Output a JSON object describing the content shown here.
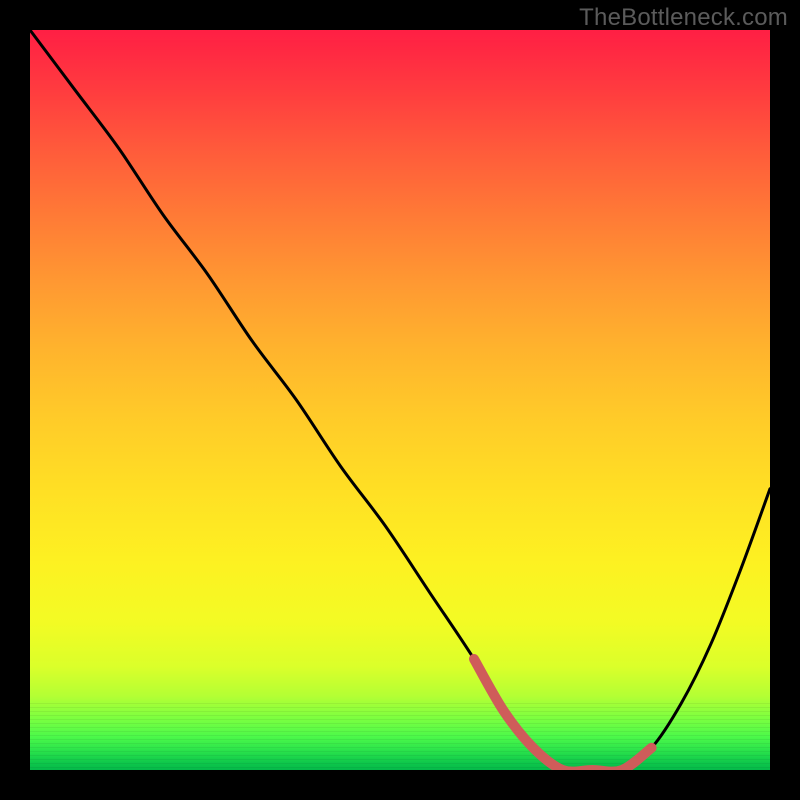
{
  "watermark": "TheBottleneck.com",
  "colors": {
    "page_bg": "#000000",
    "watermark": "#5b5b5b",
    "curve_stroke": "#000000",
    "highlight_stroke": "#cf5c5a",
    "gradient_top": "#ff1f44",
    "gradient_bottom": "#05b94a"
  },
  "chart_data": {
    "type": "line",
    "title": "",
    "xlabel": "",
    "ylabel": "",
    "xlim": [
      0,
      100
    ],
    "ylim": [
      0,
      100
    ],
    "series": [
      {
        "name": "bottleneck-curve",
        "x": [
          0,
          6,
          12,
          18,
          24,
          30,
          36,
          42,
          48,
          54,
          60,
          64,
          68,
          72,
          76,
          80,
          84,
          88,
          92,
          96,
          100
        ],
        "values": [
          100,
          92,
          84,
          75,
          67,
          58,
          50,
          41,
          33,
          24,
          15,
          8,
          3,
          0,
          0,
          0,
          3,
          9,
          17,
          27,
          38
        ]
      }
    ],
    "highlight_range_x": [
      60,
      84
    ],
    "grid": false,
    "legend": false
  }
}
